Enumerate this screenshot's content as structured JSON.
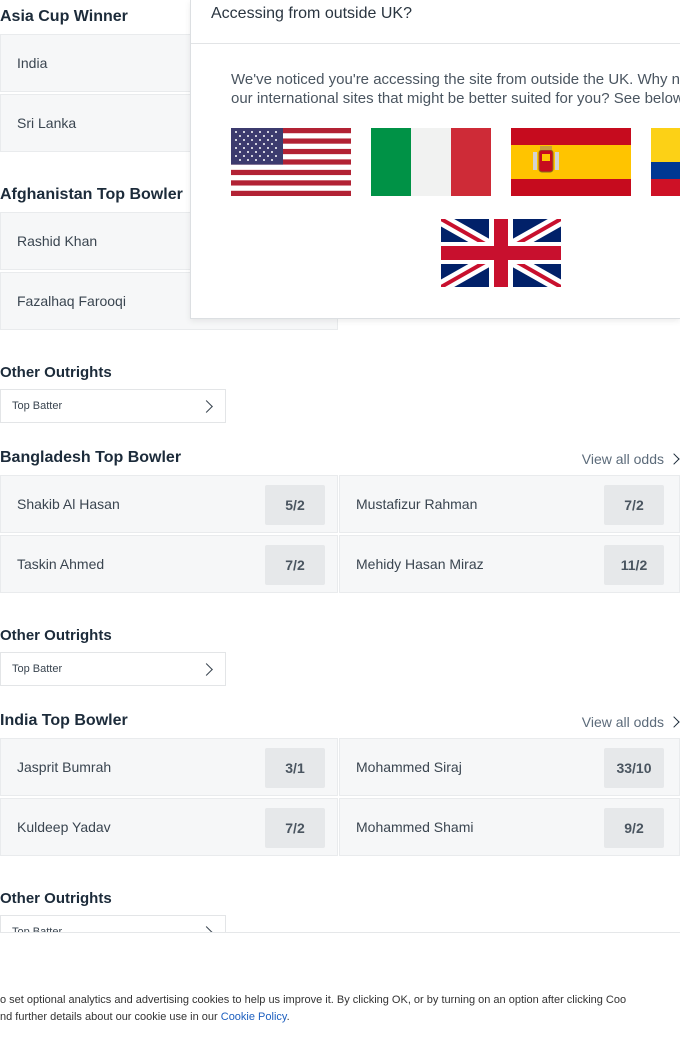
{
  "sections": [
    {
      "title": "Asia Cup Winner",
      "runners": [
        [
          "India",
          ""
        ],
        [
          "Sri Lanka",
          ""
        ]
      ]
    },
    {
      "title": "Afghanistan Top Bowler",
      "runners": [
        [
          "Rashid Khan",
          ""
        ],
        [
          "Fazalhaq Farooqi",
          ""
        ]
      ]
    },
    {
      "title": "Bangladesh Top Bowler",
      "view_all": "View all odds",
      "runners": [
        [
          "Shakib Al Hasan",
          "5/2"
        ],
        [
          "Mustafizur Rahman",
          "7/2"
        ],
        [
          "Taskin Ahmed",
          "7/2"
        ],
        [
          "Mehidy Hasan Miraz",
          "11/2"
        ]
      ]
    },
    {
      "title": "India Top Bowler",
      "view_all": "View all odds",
      "runners": [
        [
          "Jasprit Bumrah",
          "3/1"
        ],
        [
          "Mohammed Siraj",
          "33/10"
        ],
        [
          "Kuldeep Yadav",
          "7/2"
        ],
        [
          "Mohammed Shami",
          "9/2"
        ]
      ]
    }
  ],
  "other_outrights": [
    {
      "title": "Other Outrights",
      "selector": "Top Batter"
    },
    {
      "title": "Other Outrights",
      "selector": "Top Batter"
    },
    {
      "title": "Other Outrights",
      "selector": "Top Batter"
    }
  ],
  "modal": {
    "title": "Accessing from outside UK?",
    "body_line1": "We've noticed you're accessing the site from outside the UK. Why n",
    "body_line2": "our international sites that might be better suited for you? See below",
    "flags": [
      "us-flag",
      "italy-flag",
      "spain-flag",
      "colombia-flag",
      "uk-flag"
    ]
  },
  "cookie": {
    "line1": "o set optional analytics and advertising cookies to help us improve it. By clicking OK, or by turning on an option after clicking Coo",
    "line2_prefix": "nd further details about our cookie use in our ",
    "link": "Cookie Policy",
    "line2_suffix": "."
  }
}
